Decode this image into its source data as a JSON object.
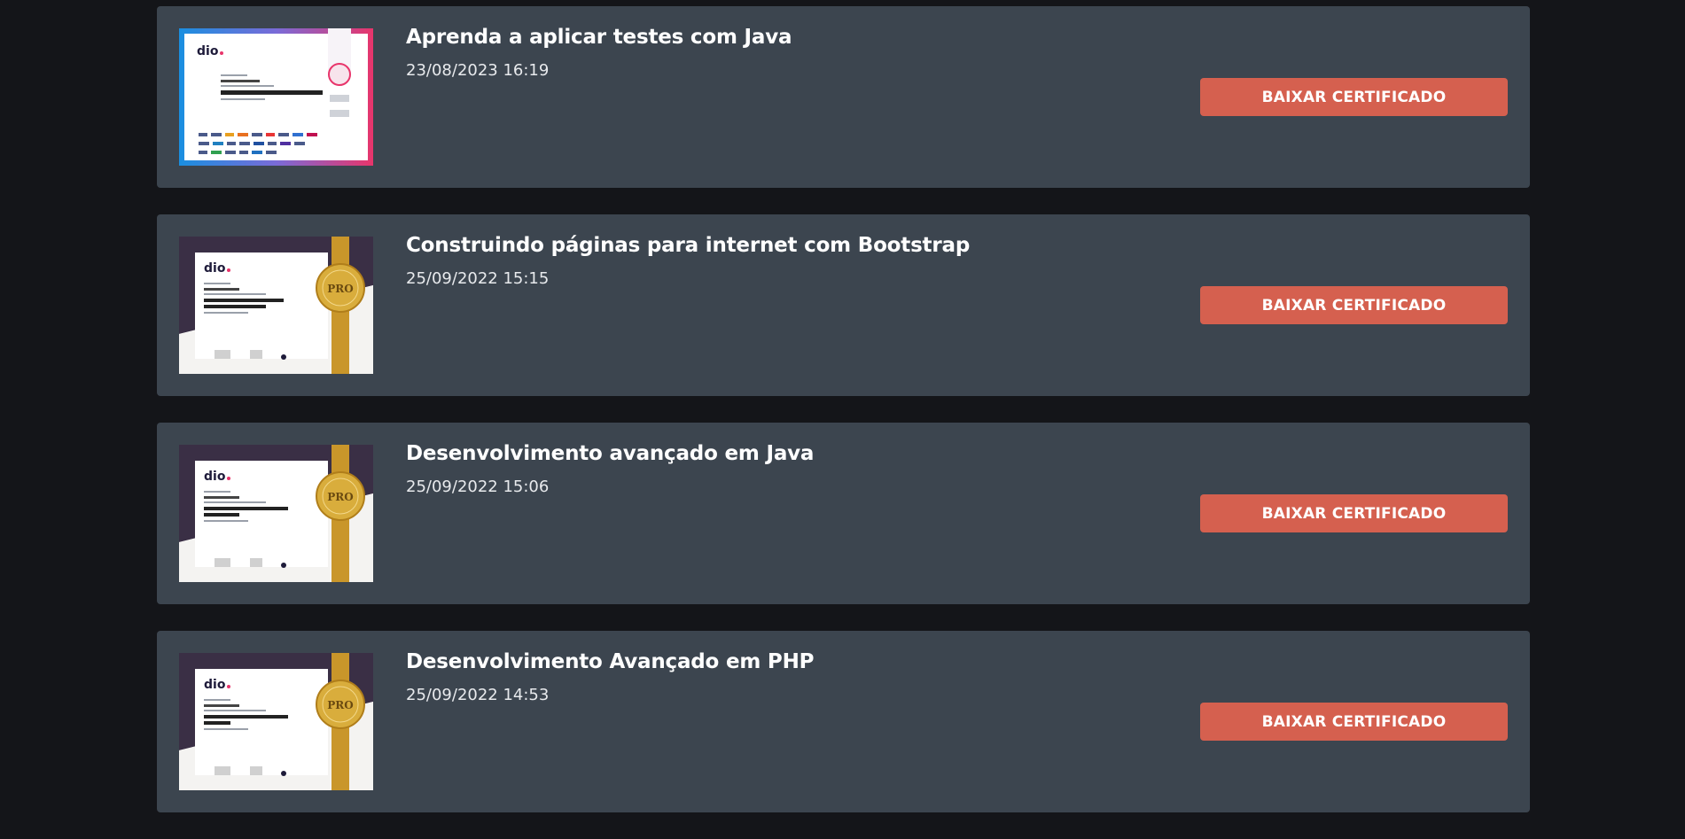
{
  "certificates": [
    {
      "title": "Aprenda a aplicar testes com Java",
      "date": "23/08/2023 16:19",
      "button_label": "BAIXAR CERTIFICADO",
      "thumbnail_style": "partners-frame"
    },
    {
      "title": "Construindo páginas para internet com Bootstrap",
      "date": "25/09/2022 15:15",
      "button_label": "BAIXAR CERTIFICADO",
      "thumbnail_style": "pro-gold-ribbon"
    },
    {
      "title": "Desenvolvimento avançado em Java",
      "date": "25/09/2022 15:06",
      "button_label": "BAIXAR CERTIFICADO",
      "thumbnail_style": "pro-gold-ribbon"
    },
    {
      "title": "Desenvolvimento Avançado em PHP",
      "date": "25/09/2022 14:53",
      "button_label": "BAIXAR CERTIFICADO",
      "thumbnail_style": "pro-gold-ribbon"
    }
  ],
  "colors": {
    "page_background": "#141519",
    "card_background": "#3c454f",
    "button": "#d5604f",
    "ribbon_gold": "#c9962a"
  }
}
